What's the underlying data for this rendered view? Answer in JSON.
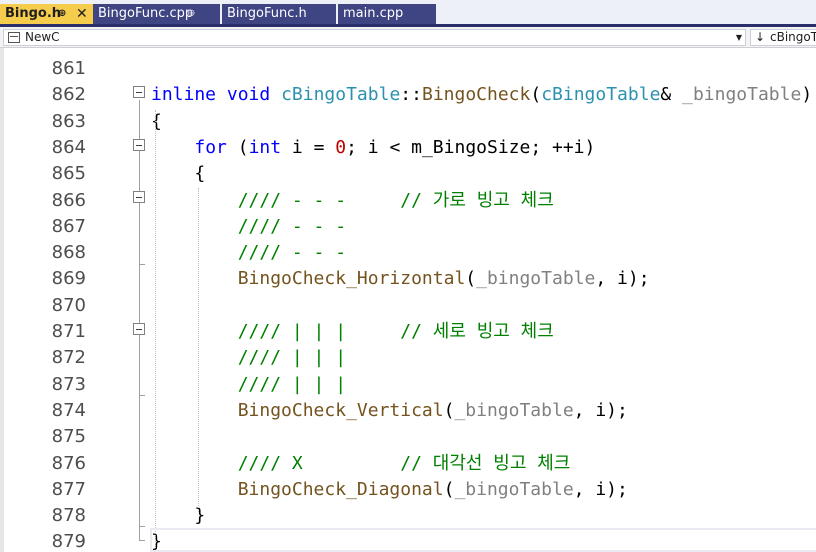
{
  "tabs": [
    {
      "label": "Bingo.h",
      "active": true,
      "pin": "⊕",
      "close": "✕"
    },
    {
      "label": "BingoFunc.cpp",
      "active": false,
      "pin": "⊕"
    },
    {
      "label": "BingoFunc.h",
      "active": false
    },
    {
      "label": "main.cpp",
      "active": false
    }
  ],
  "nav": {
    "scope": "NewC",
    "dropdown_glyph": "▼",
    "member_arrow": "↓",
    "member": "cBingoTable"
  },
  "colors": {
    "accent": "#f5cc4c",
    "tab_inactive": "#3f4482",
    "keyword": "#0000ff",
    "type": "#2b91af",
    "comment": "#008000"
  },
  "code": {
    "lines": [
      {
        "n": "861",
        "tokens": []
      },
      {
        "n": "862",
        "tokens": [
          {
            "t": "kw",
            "v": "inline"
          },
          {
            "t": "plain",
            "v": " "
          },
          {
            "t": "kw",
            "v": "void"
          },
          {
            "t": "plain",
            "v": " "
          },
          {
            "t": "cls",
            "v": "cBingoTable"
          },
          {
            "t": "plain",
            "v": "::"
          },
          {
            "t": "fn",
            "v": "BingoCheck"
          },
          {
            "t": "plain",
            "v": "("
          },
          {
            "t": "cls",
            "v": "cBingoTable"
          },
          {
            "t": "plain",
            "v": "& "
          },
          {
            "t": "param",
            "v": "_bingoTable"
          },
          {
            "t": "plain",
            "v": ")"
          }
        ]
      },
      {
        "n": "863",
        "tokens": [
          {
            "t": "plain",
            "v": "{"
          }
        ]
      },
      {
        "n": "864",
        "tokens": [
          {
            "t": "plain",
            "v": "    "
          },
          {
            "t": "kw",
            "v": "for"
          },
          {
            "t": "plain",
            "v": " ("
          },
          {
            "t": "kw",
            "v": "int"
          },
          {
            "t": "plain",
            "v": " i = "
          },
          {
            "t": "num",
            "v": "0"
          },
          {
            "t": "plain",
            "v": "; i < m_BingoSize; ++i)"
          }
        ]
      },
      {
        "n": "865",
        "tokens": [
          {
            "t": "plain",
            "v": "    {"
          }
        ]
      },
      {
        "n": "866",
        "tokens": [
          {
            "t": "plain",
            "v": "        "
          },
          {
            "t": "cmt",
            "v": "//// - - -     // 가로 빙고 체크"
          }
        ]
      },
      {
        "n": "867",
        "tokens": [
          {
            "t": "plain",
            "v": "        "
          },
          {
            "t": "cmt",
            "v": "//// - - -"
          }
        ]
      },
      {
        "n": "868",
        "tokens": [
          {
            "t": "plain",
            "v": "        "
          },
          {
            "t": "cmt",
            "v": "//// - - -"
          }
        ]
      },
      {
        "n": "869",
        "tokens": [
          {
            "t": "plain",
            "v": "        "
          },
          {
            "t": "fn",
            "v": "BingoCheck_Horizontal"
          },
          {
            "t": "plain",
            "v": "("
          },
          {
            "t": "param",
            "v": "_bingoTable"
          },
          {
            "t": "plain",
            "v": ", i);"
          }
        ]
      },
      {
        "n": "870",
        "tokens": []
      },
      {
        "n": "871",
        "tokens": [
          {
            "t": "plain",
            "v": "        "
          },
          {
            "t": "cmt",
            "v": "//// | | |     // 세로 빙고 체크"
          }
        ]
      },
      {
        "n": "872",
        "tokens": [
          {
            "t": "plain",
            "v": "        "
          },
          {
            "t": "cmt",
            "v": "//// | | |"
          }
        ]
      },
      {
        "n": "873",
        "tokens": [
          {
            "t": "plain",
            "v": "        "
          },
          {
            "t": "cmt",
            "v": "//// | | |"
          }
        ]
      },
      {
        "n": "874",
        "tokens": [
          {
            "t": "plain",
            "v": "        "
          },
          {
            "t": "fn",
            "v": "BingoCheck_Vertical"
          },
          {
            "t": "plain",
            "v": "("
          },
          {
            "t": "param",
            "v": "_bingoTable"
          },
          {
            "t": "plain",
            "v": ", i);"
          }
        ]
      },
      {
        "n": "875",
        "tokens": []
      },
      {
        "n": "876",
        "tokens": [
          {
            "t": "plain",
            "v": "        "
          },
          {
            "t": "cmt",
            "v": "//// X         // 대각선 빙고 체크"
          }
        ]
      },
      {
        "n": "877",
        "tokens": [
          {
            "t": "plain",
            "v": "        "
          },
          {
            "t": "fn",
            "v": "BingoCheck_Diagonal"
          },
          {
            "t": "plain",
            "v": "("
          },
          {
            "t": "param",
            "v": "_bingoTable"
          },
          {
            "t": "plain",
            "v": ", i);"
          }
        ]
      },
      {
        "n": "878",
        "tokens": [
          {
            "t": "plain",
            "v": "    }"
          }
        ]
      },
      {
        "n": "879",
        "tokens": [
          {
            "t": "plain",
            "v": "}"
          }
        ]
      }
    ]
  }
}
